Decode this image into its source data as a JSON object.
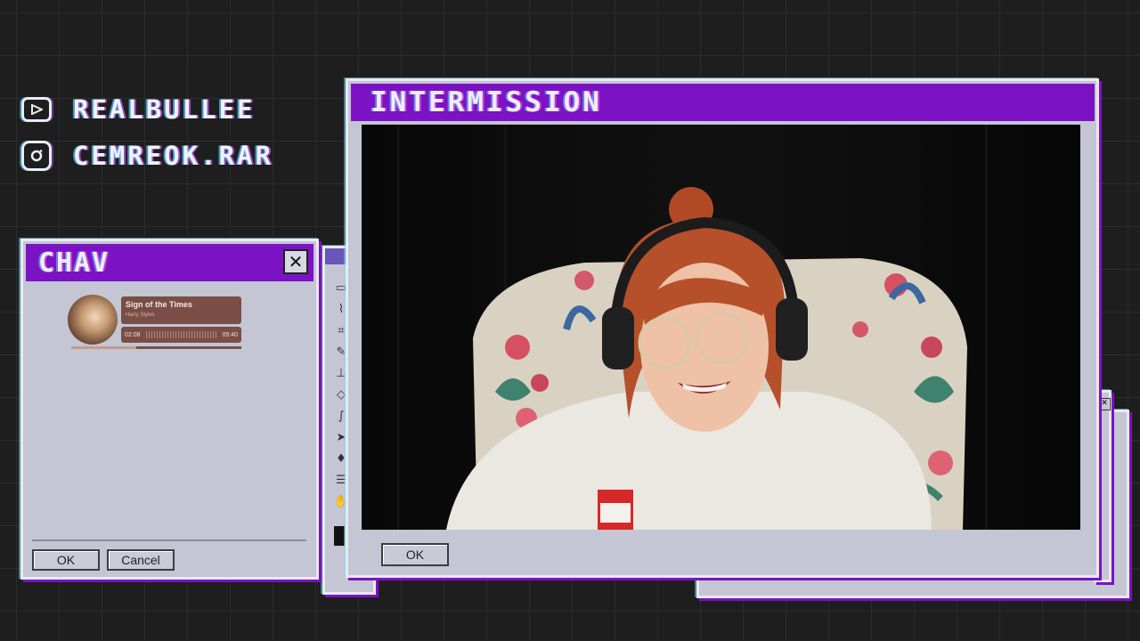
{
  "overlay": {
    "socials": [
      {
        "platform": "youtube-icon",
        "handle": "REALBULLEE"
      },
      {
        "platform": "instagram-icon",
        "handle": "CEMREOK.RAR"
      }
    ]
  },
  "chat_window": {
    "title": "CHAV",
    "close_label": "✕",
    "now_playing": {
      "song": "Sign of the Times",
      "artist": "Harry Styles",
      "elapsed": "02:08",
      "duration": "05:40",
      "progress": 0.38
    },
    "ok_label": "OK",
    "cancel_label": "Cancel"
  },
  "main_window": {
    "title": "INTERMISSION",
    "ok_label": "OK"
  },
  "colors": {
    "accent": "#7b12c3",
    "window_bg": "#c4c6d3",
    "player_card": "#7a4e46",
    "background": "#1e1e1f"
  }
}
